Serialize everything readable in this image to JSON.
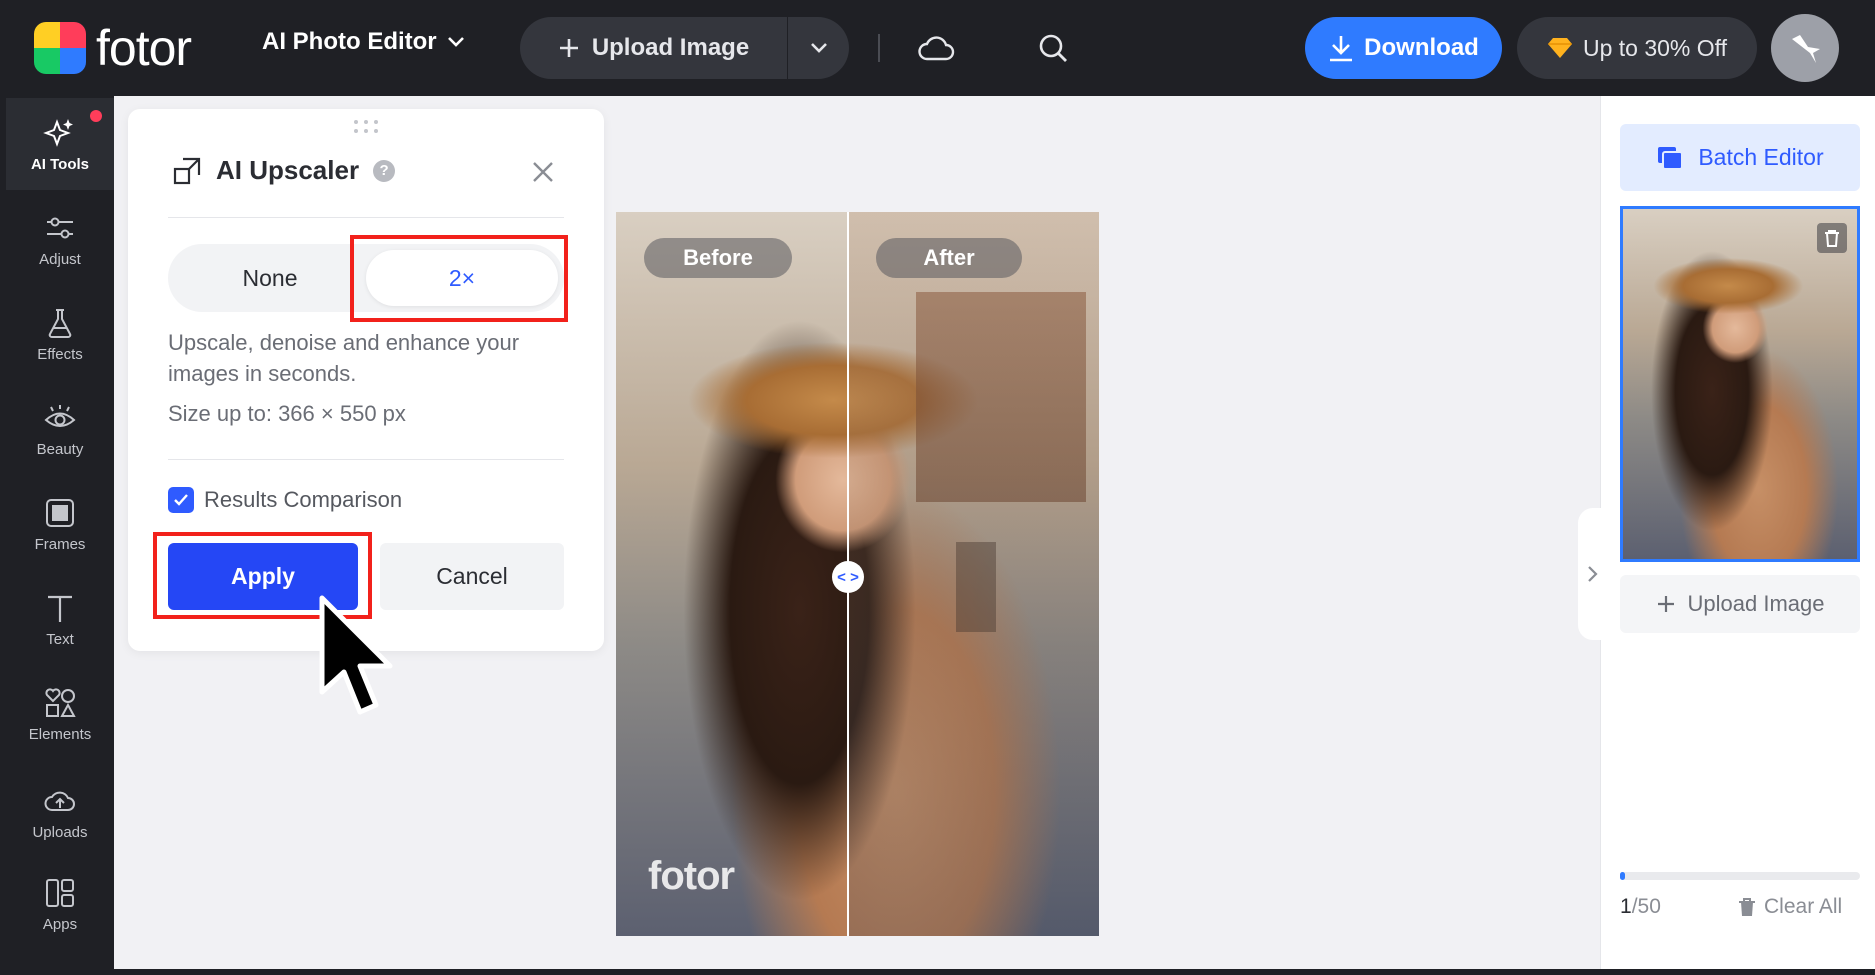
{
  "header": {
    "logo_text": "fotor",
    "mode_label": "AI Photo Editor",
    "upload_label": "Upload Image",
    "download_label": "Download",
    "promo_label": "Up to 30% Off"
  },
  "sidebar": {
    "items": [
      {
        "label": "AI Tools",
        "icon": "sparkle-icon"
      },
      {
        "label": "Adjust",
        "icon": "sliders-icon"
      },
      {
        "label": "Effects",
        "icon": "flask-icon"
      },
      {
        "label": "Beauty",
        "icon": "eye-icon"
      },
      {
        "label": "Frames",
        "icon": "frame-icon"
      },
      {
        "label": "Text",
        "icon": "text-icon"
      },
      {
        "label": "Elements",
        "icon": "shapes-icon"
      },
      {
        "label": "Uploads",
        "icon": "cloud-upload-icon"
      },
      {
        "label": "Apps",
        "icon": "apps-icon"
      }
    ]
  },
  "upscaler": {
    "title": "AI Upscaler",
    "options": [
      "None",
      "2×"
    ],
    "selected_option": "2×",
    "description": "Upscale, denoise and enhance your images in seconds.",
    "size_text": "Size up to: 366 × 550 px",
    "comparison_label": "Results Comparison",
    "comparison_checked": true,
    "apply_label": "Apply",
    "cancel_label": "Cancel"
  },
  "preview": {
    "before_label": "Before",
    "after_label": "After",
    "watermark": "fotor",
    "handle_glyph": "< >"
  },
  "right_panel": {
    "batch_label": "Batch Editor",
    "upload_label": "Upload Image",
    "count_current": "1",
    "count_total": "/50",
    "progress_fraction": 0.02,
    "clear_label": "Clear All"
  },
  "colors": {
    "accent": "#2f7bff",
    "apply_blue": "#2547f5",
    "highlight_red": "#f2211b",
    "topbar": "#1f2025"
  }
}
